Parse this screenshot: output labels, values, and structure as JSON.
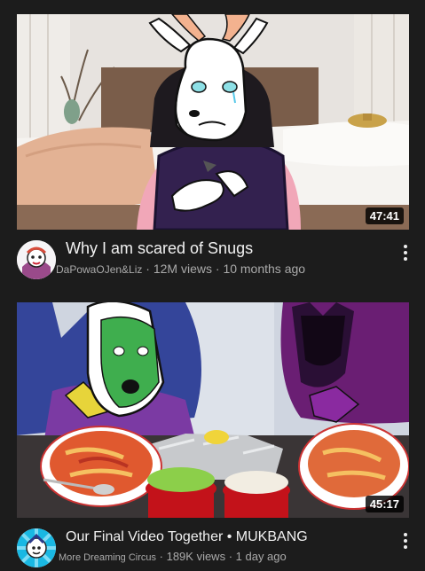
{
  "videos": [
    {
      "title": "Why I am scared of Snugs",
      "channel": "DaPowaOJen&Liz",
      "views": "12M views",
      "age": "10 months ago",
      "duration": "47:41",
      "separator": " · "
    },
    {
      "title": "Our Final Video Together • MUKBANG",
      "channel": "More Dreaming Circus",
      "views": "189K views",
      "age": "1 day ago",
      "duration": "45:17",
      "separator": " · "
    }
  ],
  "icons": {
    "menu": "more-vert-icon"
  },
  "colors": {
    "background": "#1c1c1c",
    "meta_text": "#aaaaaa",
    "title_text": "#f1f1f1"
  }
}
